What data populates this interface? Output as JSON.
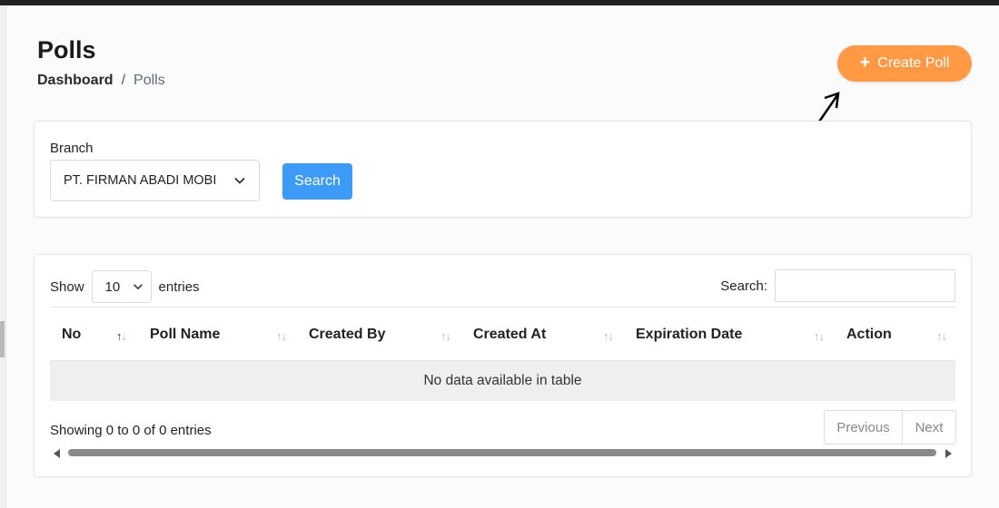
{
  "page": {
    "title": "Polls"
  },
  "breadcrumb": {
    "home": "Dashboard",
    "separator": "/",
    "current": "Polls"
  },
  "create_button": {
    "label": "Create Poll",
    "icon": "plus-icon",
    "color": "#ff9944"
  },
  "filter": {
    "branch_label": "Branch",
    "branch_value": "PT. FIRMAN ABADI MOBI",
    "search_label": "Search",
    "search_color": "#3d9bf8"
  },
  "table": {
    "show_label": "Show",
    "page_length": "10",
    "entries_label": "entries",
    "search_label": "Search:",
    "columns": [
      "No",
      "Poll Name",
      "Created By",
      "Created At",
      "Expiration Date",
      "Action"
    ],
    "empty_message": "No data available in table",
    "info": "Showing 0 to 0 of 0 entries",
    "prev_label": "Previous",
    "next_label": "Next"
  }
}
